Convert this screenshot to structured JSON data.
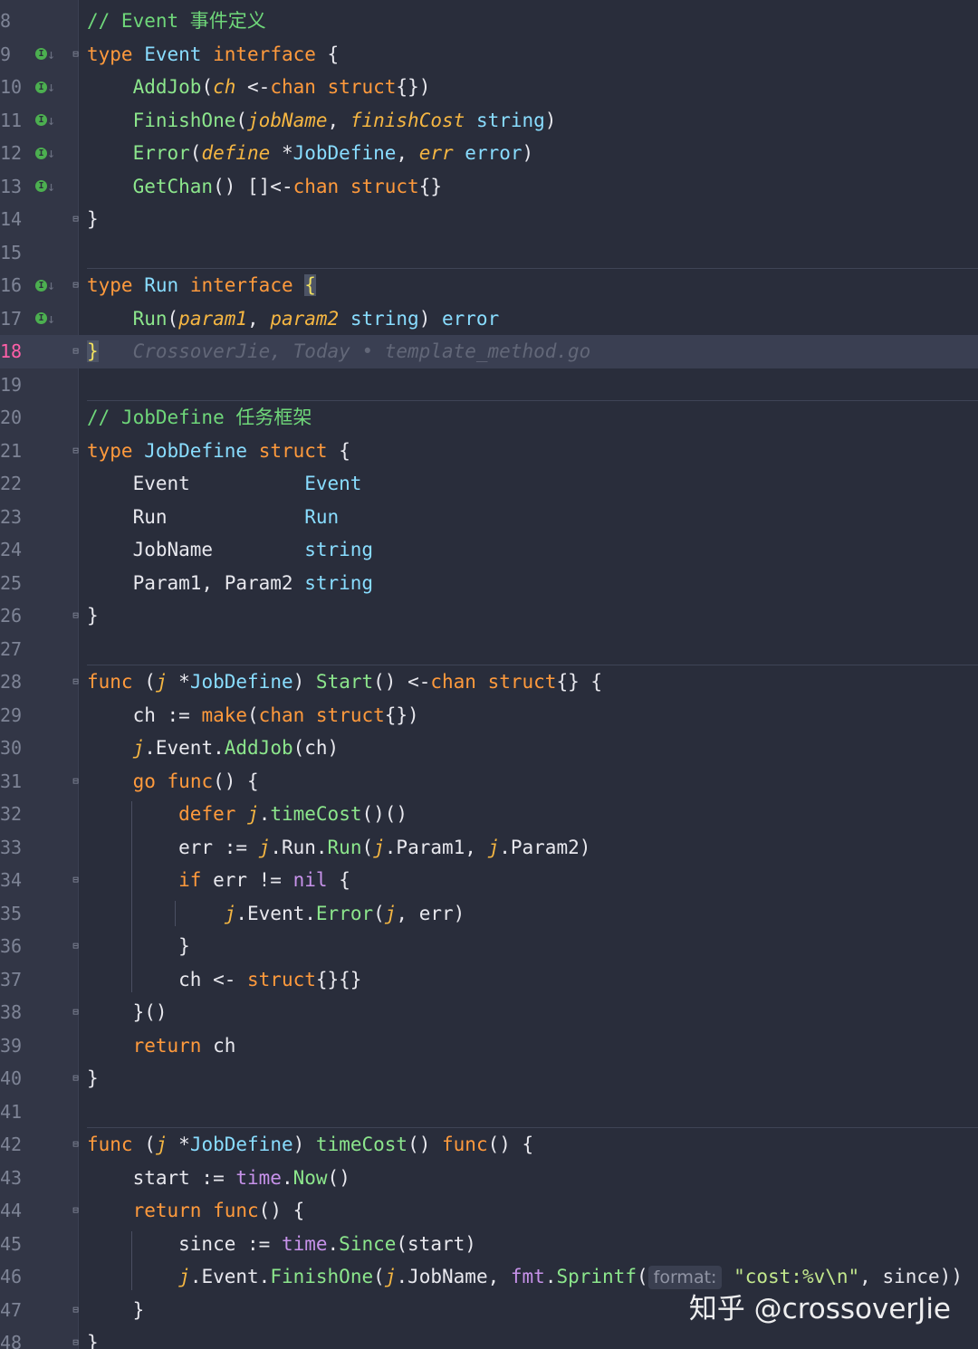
{
  "code_lines": [
    {
      "n": "8",
      "text": "// Event 事件定义"
    },
    {
      "n": "9",
      "text": "type Event interface {"
    },
    {
      "n": "10",
      "text": "AddJob(ch <-chan struct{})"
    },
    {
      "n": "11",
      "text": "FinishOne(jobName, finishCost string)"
    },
    {
      "n": "12",
      "text": "Error(define *JobDefine, err error)"
    },
    {
      "n": "13",
      "text": "GetChan() []<-chan struct{}"
    },
    {
      "n": "14",
      "text": "}"
    },
    {
      "n": "15",
      "text": ""
    },
    {
      "n": "16",
      "text": "type Run interface {"
    },
    {
      "n": "17",
      "text": "Run(param1, param2 string) error"
    },
    {
      "n": "18",
      "text": "}"
    },
    {
      "n": "19",
      "text": ""
    },
    {
      "n": "20",
      "text": "// JobDefine 任务框架"
    },
    {
      "n": "21",
      "text": "type JobDefine struct {"
    },
    {
      "n": "22",
      "text": "Event Event"
    },
    {
      "n": "23",
      "text": "Run Run"
    },
    {
      "n": "24",
      "text": "JobName string"
    },
    {
      "n": "25",
      "text": "Param1, Param2 string"
    },
    {
      "n": "26",
      "text": "}"
    },
    {
      "n": "27",
      "text": ""
    },
    {
      "n": "28",
      "text": "func (j *JobDefine) Start() <-chan struct{} {"
    },
    {
      "n": "29",
      "text": "ch := make(chan struct{})"
    },
    {
      "n": "30",
      "text": "j.Event.AddJob(ch)"
    },
    {
      "n": "31",
      "text": "go func() {"
    },
    {
      "n": "32",
      "text": "defer j.timeCost()()"
    },
    {
      "n": "33",
      "text": "err := j.Run.Run(j.Param1, j.Param2)"
    },
    {
      "n": "34",
      "text": "if err != nil {"
    },
    {
      "n": "35",
      "text": "j.Event.Error(j, err)"
    },
    {
      "n": "36",
      "text": "}"
    },
    {
      "n": "37",
      "text": "ch <- struct{}{}"
    },
    {
      "n": "38",
      "text": "}()"
    },
    {
      "n": "39",
      "text": "return ch"
    },
    {
      "n": "40",
      "text": "}"
    },
    {
      "n": "41",
      "text": ""
    },
    {
      "n": "42",
      "text": "func (j *JobDefine) timeCost() func() {"
    },
    {
      "n": "43",
      "text": "start := time.Now()"
    },
    {
      "n": "44",
      "text": "return func() {"
    },
    {
      "n": "45",
      "text": "since := time.Since(start)"
    },
    {
      "n": "46",
      "text": "j.Event.FinishOne(j.JobName, fmt.Sprintf(format: \"cost:%v\\n\", since))"
    },
    {
      "n": "47",
      "text": "}"
    },
    {
      "n": "48",
      "text": "}"
    }
  ],
  "current_line": "18",
  "git_blame": "CrossoverJie, Today • template_method.go",
  "param_hint": "format:",
  "watermark": "知乎 @crossoverJie",
  "colors": {
    "background": "#292d3b",
    "gutter": "#323646",
    "keyword": "#ff9a3c",
    "type": "#89ddff",
    "function": "#8ce68c",
    "param": "#f5b642",
    "comment": "#6fd77a",
    "current_line_number": "#ff5fa8"
  },
  "gutter_icons": {
    "implements": "implemented-method-icon",
    "fold": "fold-marker-icon"
  }
}
